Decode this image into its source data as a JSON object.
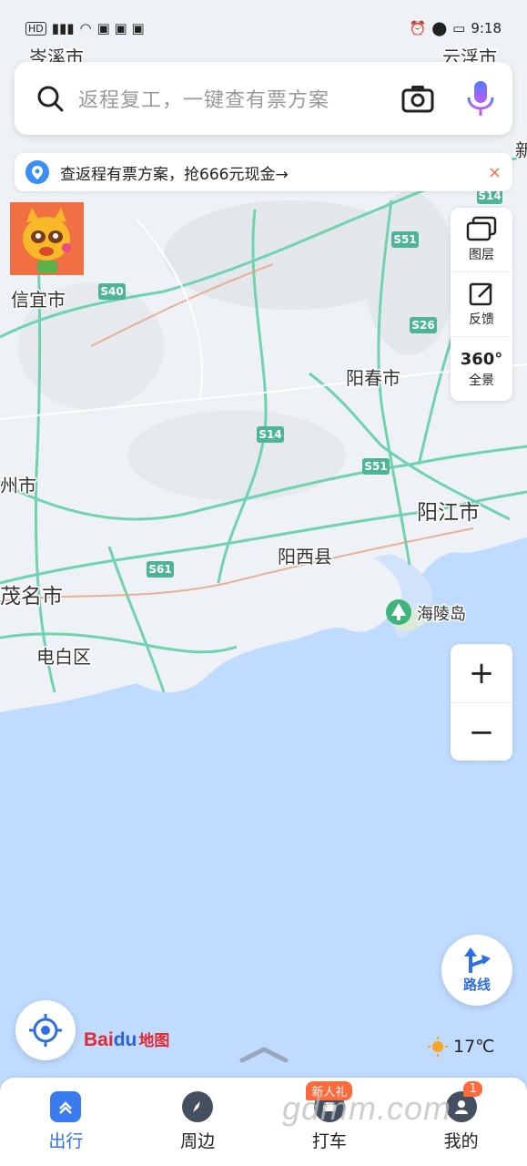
{
  "status": {
    "left_icons": "HD 5G signal wifi",
    "time": "9:18"
  },
  "search": {
    "placeholder": "返程复工，一键查有票方案"
  },
  "tip": {
    "text": "查返程有票方案，抢666元现金→",
    "close": "×"
  },
  "tools": {
    "layers": "图层",
    "feedback": "反馈",
    "panorama": "全景",
    "panorama_badge": "360°"
  },
  "zoom": {
    "in": "+",
    "out": "−"
  },
  "route": {
    "label": "路线"
  },
  "logo": {
    "part1": "Bai",
    "part2": "du",
    "part3": "地图"
  },
  "weather": {
    "temp": "17℃"
  },
  "map": {
    "cities": [
      "岑溪市",
      "云浮市",
      "信宜市",
      "阳春市",
      "阳江市",
      "阳西县",
      "茂名市",
      "电白区",
      "州市",
      "海陵岛",
      "新"
    ],
    "roads": [
      "S14",
      "S51",
      "S40",
      "S26",
      "S14",
      "S51",
      "S61"
    ]
  },
  "nav": [
    {
      "label": "出行",
      "active": true
    },
    {
      "label": "周边"
    },
    {
      "label": "打车",
      "badge": "新人礼"
    },
    {
      "label": "我的",
      "badge": "1"
    }
  ],
  "watermark": "gdmm.com",
  "colors": {
    "accent": "#2d6fe6",
    "sea": "#bfdbff",
    "land": "#eef1f5",
    "highway": "#6fd3b0"
  }
}
